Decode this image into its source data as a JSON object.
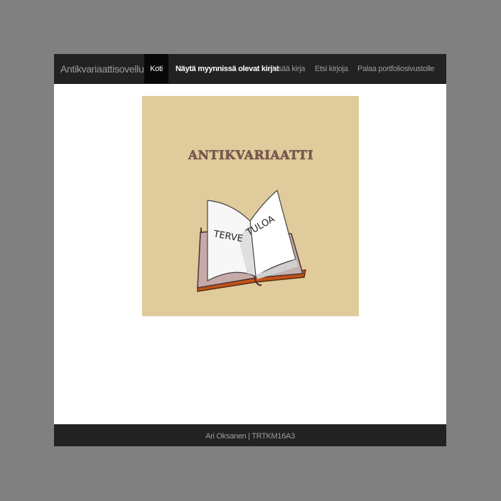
{
  "navbar": {
    "brand": "Antikvariaattisovellus",
    "items": [
      {
        "label": "Koti",
        "active": true
      },
      {
        "label": "Näytä myynnissä olevat kirjat",
        "active": false
      },
      {
        "label": "Lisää kirja",
        "active": false
      },
      {
        "label": "Etsi kirjoja",
        "active": false
      },
      {
        "label": "Palaa portfoliosivustolle",
        "active": false
      }
    ]
  },
  "hero": {
    "title": "ANTIKVARIAATTI",
    "left_page_text": "TERVE",
    "right_page_text": "TULOA",
    "background_color": "#dfcb9b",
    "title_color": "#7b5a52"
  },
  "footer": {
    "text": "Ari Oksanen | TRTKM16A3"
  },
  "colors": {
    "page_background": "#808080",
    "navbar": "#222222",
    "active_nav": "#080808",
    "nav_text": "#9d9d9d"
  }
}
